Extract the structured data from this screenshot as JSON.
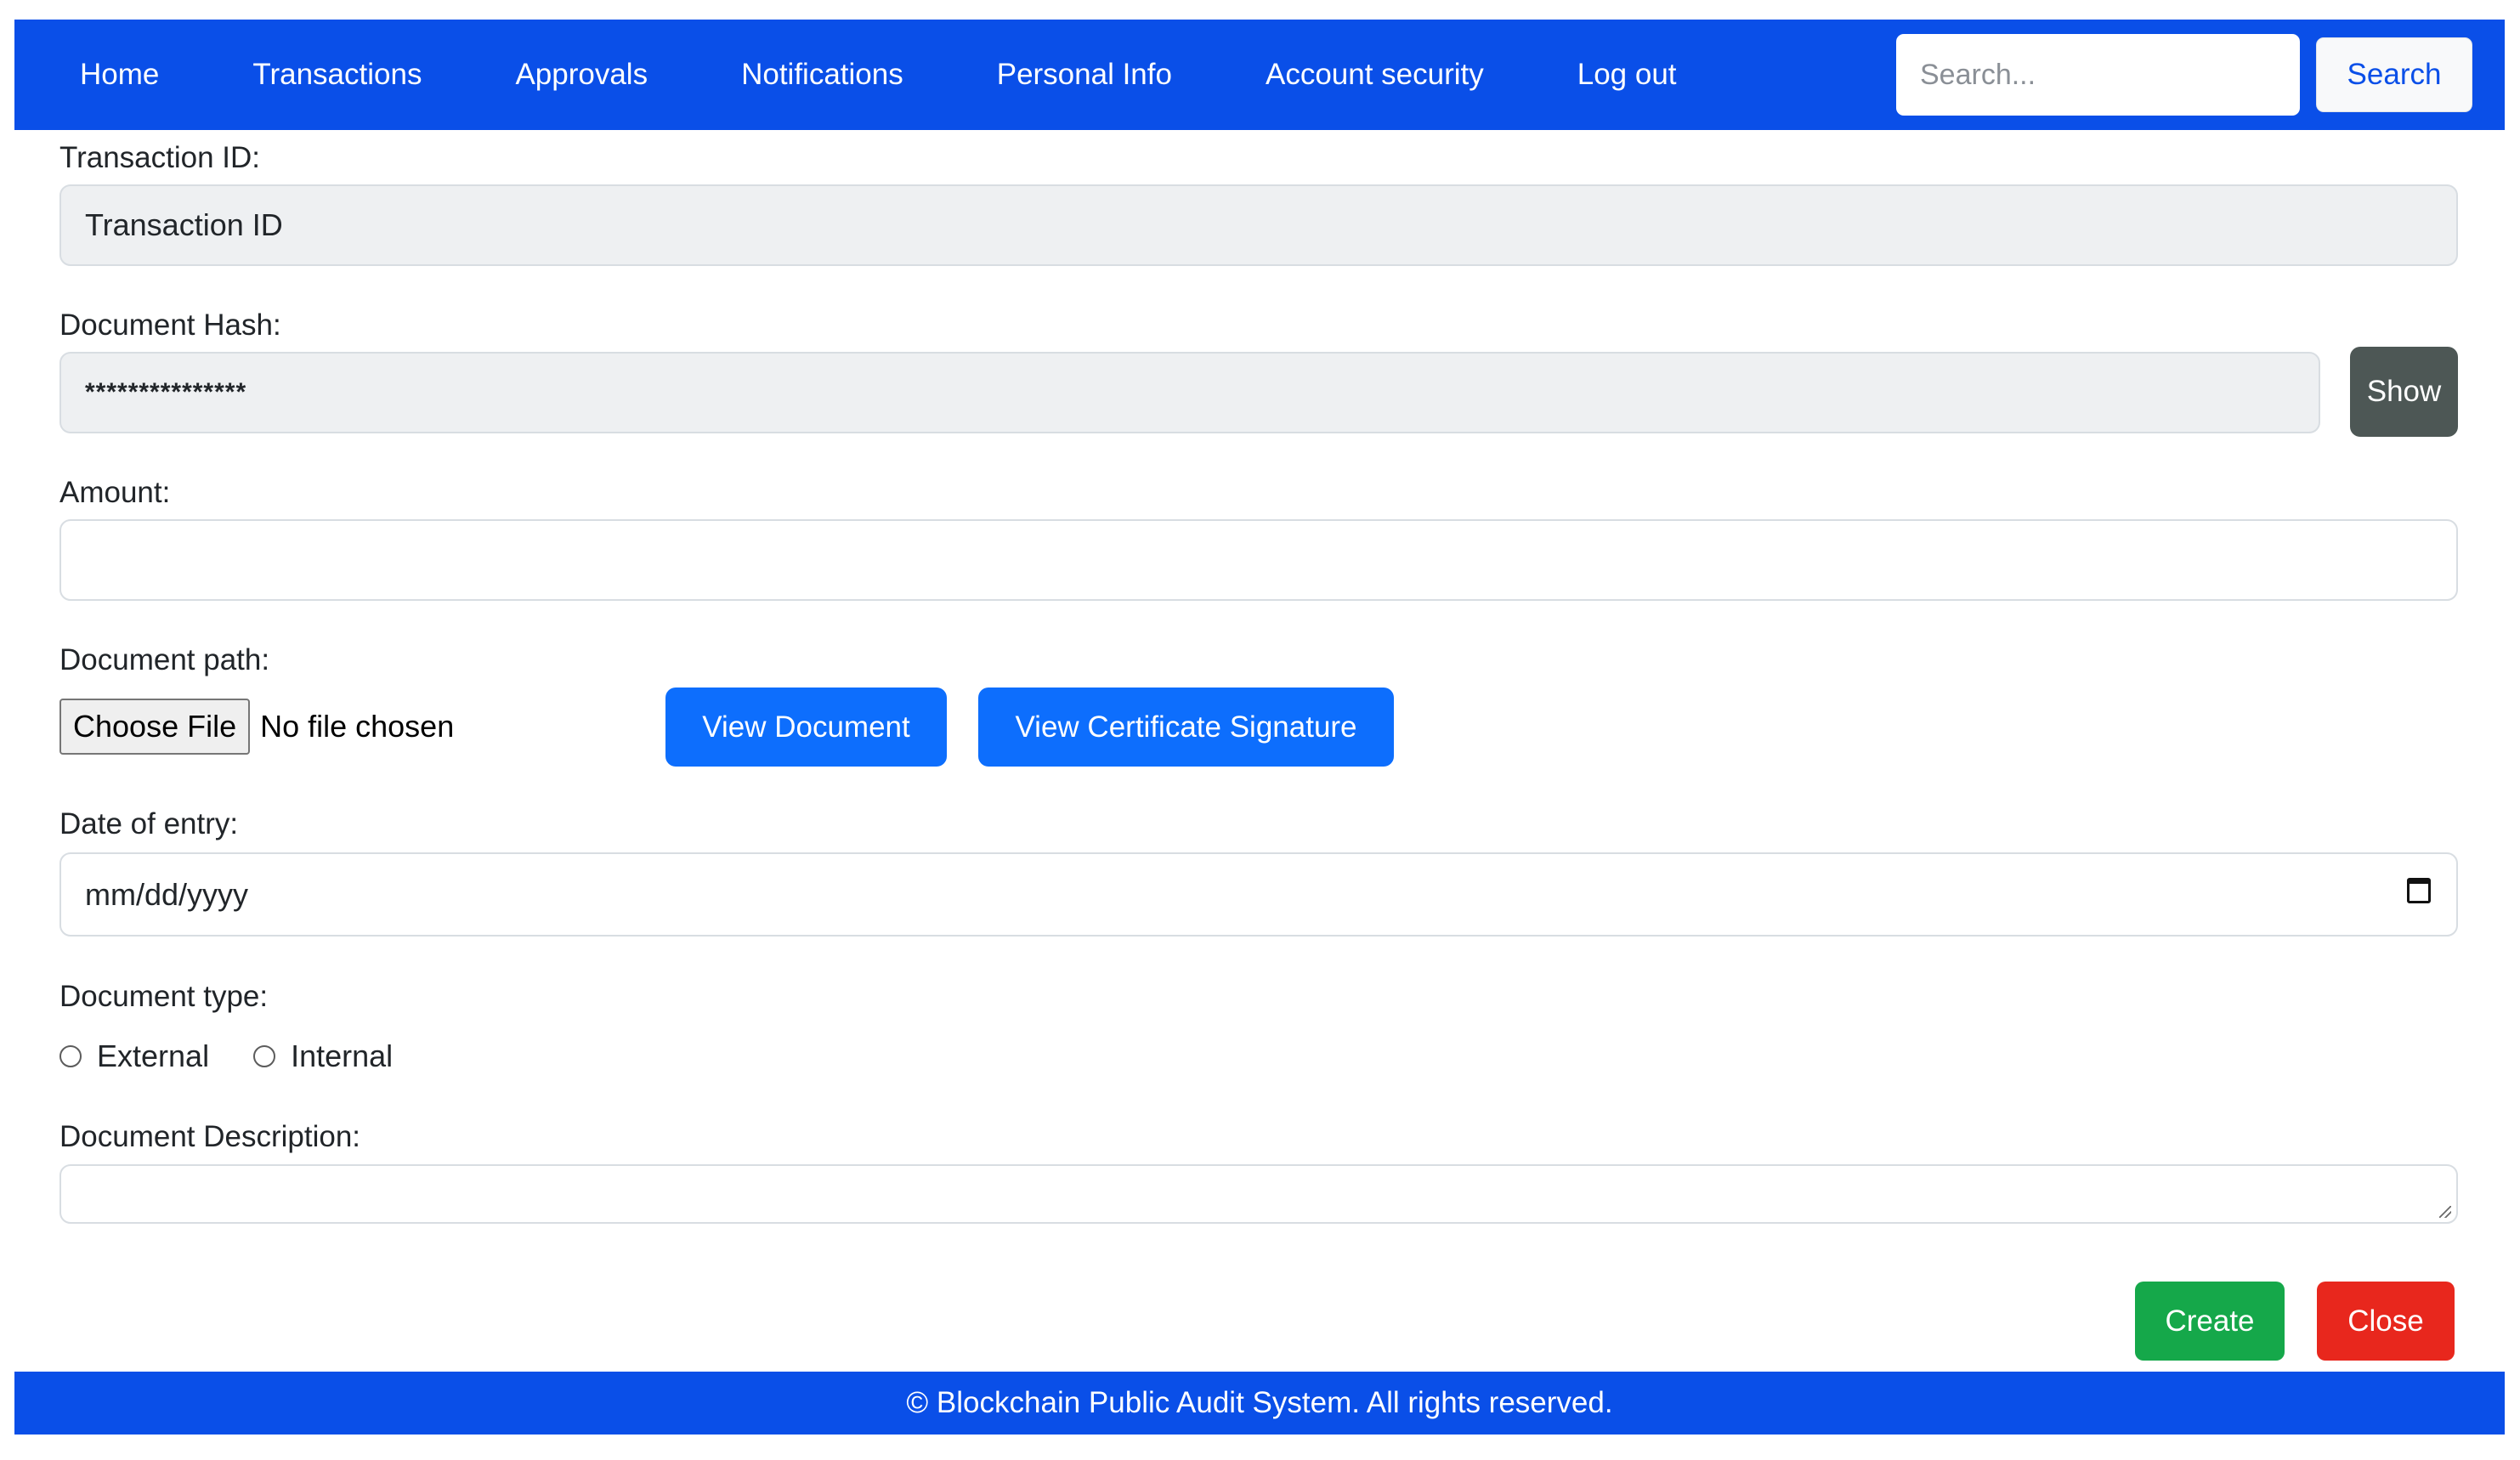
{
  "nav": {
    "items": [
      "Home",
      "Transactions",
      "Approvals",
      "Notifications",
      "Personal Info",
      "Account security",
      "Log out"
    ],
    "search_placeholder": "Search...",
    "search_button": "Search"
  },
  "form": {
    "transaction_id": {
      "label": "Transaction ID:",
      "value": "Transaction ID"
    },
    "document_hash": {
      "label": "Document Hash:",
      "value": "***************",
      "show_button": "Show"
    },
    "amount": {
      "label": "Amount:",
      "value": ""
    },
    "document_path": {
      "label": "Document path:",
      "choose_file": "Choose File",
      "no_file": "No file chosen",
      "view_document": "View Document",
      "view_certificate": "View Certificate Signature"
    },
    "date_of_entry": {
      "label": "Date of entry:",
      "placeholder": "mm/dd/yyyy"
    },
    "document_type": {
      "label": "Document type:",
      "options": [
        "External",
        "Internal"
      ]
    },
    "document_description": {
      "label": "Document Description:",
      "value": ""
    },
    "create_button": "Create",
    "close_button": "Close"
  },
  "footer": {
    "text": "© Blockchain Public Audit System. All rights reserved."
  },
  "colors": {
    "navbar": "#0a4fe8",
    "primary_button": "#0d6efd",
    "show_button": "#4d5755",
    "create_button": "#15a84a",
    "close_button": "#e8271d",
    "readonly_field": "#eef0f2"
  }
}
